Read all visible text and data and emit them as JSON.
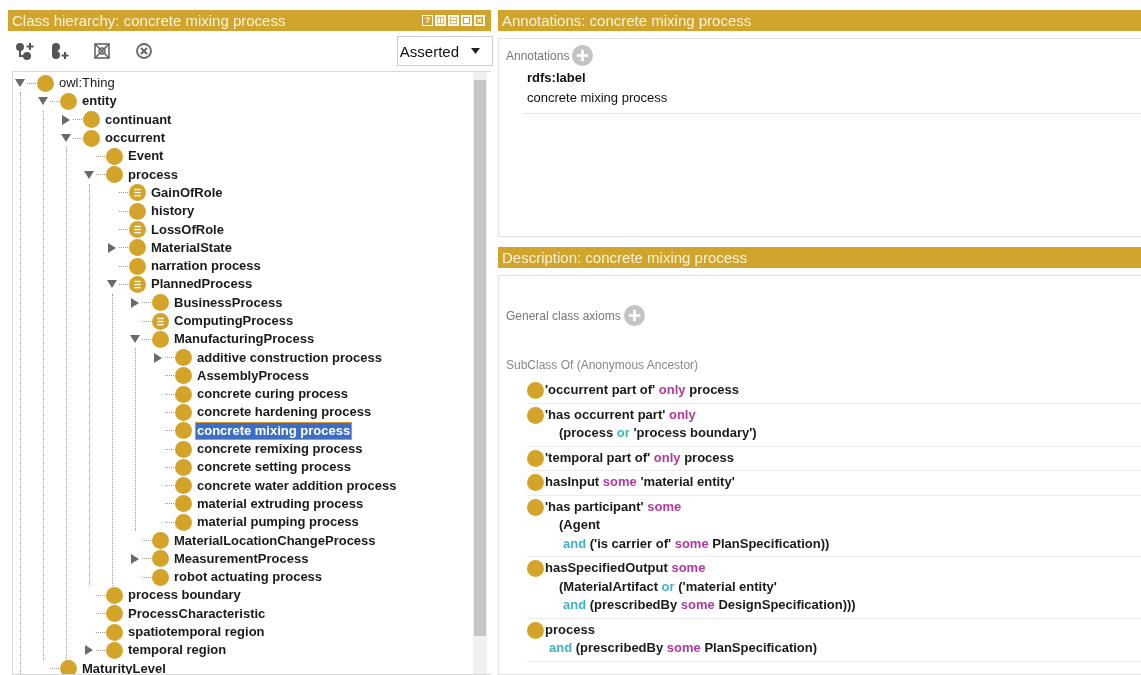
{
  "class_hierarchy": {
    "title": "Class hierarchy: concrete mixing process",
    "help_button": "?",
    "view_selector": "Asserted",
    "tree": [
      {
        "label": "owl:Thing",
        "kind": "expanded",
        "defined": false,
        "bold": false,
        "selected": false,
        "children": [
          {
            "label": "entity",
            "kind": "expanded",
            "defined": false,
            "bold": true,
            "selected": false,
            "children": [
              {
                "label": "continuant",
                "kind": "collapsed",
                "defined": false,
                "bold": true,
                "selected": false
              },
              {
                "label": "occurrent",
                "kind": "expanded",
                "defined": false,
                "bold": true,
                "selected": false,
                "children": [
                  {
                    "label": "Event",
                    "kind": "leaf",
                    "defined": false,
                    "bold": true,
                    "selected": false
                  },
                  {
                    "label": "process",
                    "kind": "expanded",
                    "defined": false,
                    "bold": true,
                    "selected": false,
                    "children": [
                      {
                        "label": "GainOfRole",
                        "kind": "leaf",
                        "defined": true,
                        "bold": true,
                        "selected": false
                      },
                      {
                        "label": "history",
                        "kind": "leaf",
                        "defined": false,
                        "bold": true,
                        "selected": false
                      },
                      {
                        "label": "LossOfRole",
                        "kind": "leaf",
                        "defined": true,
                        "bold": true,
                        "selected": false
                      },
                      {
                        "label": "MaterialState",
                        "kind": "collapsed",
                        "defined": false,
                        "bold": true,
                        "selected": false
                      },
                      {
                        "label": "narration process",
                        "kind": "leaf",
                        "defined": false,
                        "bold": true,
                        "selected": false
                      },
                      {
                        "label": "PlannedProcess",
                        "kind": "expanded",
                        "defined": true,
                        "bold": true,
                        "selected": false,
                        "children": [
                          {
                            "label": "BusinessProcess",
                            "kind": "collapsed",
                            "defined": false,
                            "bold": true,
                            "selected": false
                          },
                          {
                            "label": "ComputingProcess",
                            "kind": "leaf",
                            "defined": true,
                            "bold": true,
                            "selected": false
                          },
                          {
                            "label": "ManufacturingProcess",
                            "kind": "expanded",
                            "defined": false,
                            "bold": true,
                            "selected": false,
                            "children": [
                              {
                                "label": "additive construction process",
                                "kind": "collapsed",
                                "defined": false,
                                "bold": true,
                                "selected": false
                              },
                              {
                                "label": "AssemblyProcess",
                                "kind": "leaf",
                                "defined": false,
                                "bold": true,
                                "selected": false
                              },
                              {
                                "label": "concrete curing process",
                                "kind": "leaf",
                                "defined": false,
                                "bold": true,
                                "selected": false
                              },
                              {
                                "label": "concrete hardening process",
                                "kind": "leaf",
                                "defined": false,
                                "bold": true,
                                "selected": false
                              },
                              {
                                "label": "concrete mixing process",
                                "kind": "leaf",
                                "defined": false,
                                "bold": true,
                                "selected": true
                              },
                              {
                                "label": "concrete remixing process",
                                "kind": "leaf",
                                "defined": false,
                                "bold": true,
                                "selected": false
                              },
                              {
                                "label": "concrete setting process",
                                "kind": "leaf",
                                "defined": false,
                                "bold": true,
                                "selected": false
                              },
                              {
                                "label": "concrete water addition process",
                                "kind": "leaf",
                                "defined": false,
                                "bold": true,
                                "selected": false
                              },
                              {
                                "label": "material extruding process",
                                "kind": "leaf",
                                "defined": false,
                                "bold": true,
                                "selected": false
                              },
                              {
                                "label": "material pumping process",
                                "kind": "leaf",
                                "defined": false,
                                "bold": true,
                                "selected": false
                              }
                            ]
                          },
                          {
                            "label": "MaterialLocationChangeProcess",
                            "kind": "leaf",
                            "defined": false,
                            "bold": true,
                            "selected": false
                          },
                          {
                            "label": "MeasurementProcess",
                            "kind": "collapsed",
                            "defined": false,
                            "bold": true,
                            "selected": false
                          },
                          {
                            "label": "robot actuating process",
                            "kind": "leaf",
                            "defined": false,
                            "bold": true,
                            "selected": false
                          }
                        ]
                      }
                    ]
                  },
                  {
                    "label": "process boundary",
                    "kind": "leaf",
                    "defined": false,
                    "bold": true,
                    "selected": false
                  },
                  {
                    "label": "ProcessCharacteristic",
                    "kind": "leaf",
                    "defined": false,
                    "bold": true,
                    "selected": false
                  },
                  {
                    "label": "spatiotemporal region",
                    "kind": "leaf",
                    "defined": false,
                    "bold": true,
                    "selected": false
                  },
                  {
                    "label": "temporal region",
                    "kind": "collapsed",
                    "defined": false,
                    "bold": true,
                    "selected": false
                  }
                ]
              }
            ]
          },
          {
            "label": "MaturityLevel",
            "kind": "leaf",
            "defined": false,
            "bold": true,
            "selected": false
          }
        ]
      }
    ]
  },
  "annotations": {
    "title": "Annotations: concrete mixing process",
    "section_label": "Annotations",
    "items": [
      {
        "property": "rdfs:label",
        "value": "concrete mixing process"
      }
    ]
  },
  "description": {
    "title": "Description: concrete mixing process",
    "general_axioms_label": "General class axioms",
    "subclass_label": "SubClass Of (Anonymous Ancestor)",
    "axioms": [
      {
        "lines": [
          [
            {
              "text": "'occurrent part of'",
              "kind": "term"
            },
            {
              "text": "only",
              "kind": "quantifier"
            },
            {
              "text": "process",
              "kind": "term"
            }
          ]
        ]
      },
      {
        "lines": [
          [
            {
              "text": "'has occurrent part'",
              "kind": "term"
            },
            {
              "text": "only",
              "kind": "quantifier"
            }
          ],
          [
            {
              "text": "(process",
              "kind": "term"
            },
            {
              "text": "or",
              "kind": "connective"
            },
            {
              "text": "'process boundary')",
              "kind": "term"
            }
          ]
        ]
      },
      {
        "lines": [
          [
            {
              "text": "'temporal part of'",
              "kind": "term"
            },
            {
              "text": "only",
              "kind": "quantifier"
            },
            {
              "text": "process",
              "kind": "term"
            }
          ]
        ]
      },
      {
        "lines": [
          [
            {
              "text": "hasInput",
              "kind": "term"
            },
            {
              "text": "some",
              "kind": "quantifier"
            },
            {
              "text": "'material entity'",
              "kind": "term"
            }
          ]
        ]
      },
      {
        "lines": [
          [
            {
              "text": "'has participant'",
              "kind": "term"
            },
            {
              "text": "some",
              "kind": "quantifier"
            }
          ],
          [
            {
              "text": "(Agent",
              "kind": "term"
            }
          ],
          [
            {
              "text": "and",
              "kind": "connective"
            },
            {
              "text": "('is carrier of'",
              "kind": "term"
            },
            {
              "text": "some",
              "kind": "quantifier"
            },
            {
              "text": "PlanSpecification))",
              "kind": "term"
            }
          ]
        ]
      },
      {
        "lines": [
          [
            {
              "text": "hasSpecifiedOutput",
              "kind": "term"
            },
            {
              "text": "some",
              "kind": "quantifier"
            }
          ],
          [
            {
              "text": "(MaterialArtifact",
              "kind": "term"
            },
            {
              "text": "or",
              "kind": "connective"
            },
            {
              "text": "('material entity'",
              "kind": "term"
            }
          ],
          [
            {
              "text": "and",
              "kind": "connective"
            },
            {
              "text": "(prescribedBy",
              "kind": "term"
            },
            {
              "text": "some",
              "kind": "quantifier"
            },
            {
              "text": "DesignSpecification)))",
              "kind": "term"
            }
          ]
        ]
      },
      {
        "lines": [
          [
            {
              "text": "process",
              "kind": "term"
            }
          ],
          [
            {
              "text": "and",
              "kind": "connective"
            },
            {
              "text": "(prescribedBy",
              "kind": "term"
            },
            {
              "text": "some",
              "kind": "quantifier"
            },
            {
              "text": "PlanSpecification)",
              "kind": "term"
            }
          ]
        ]
      }
    ]
  }
}
